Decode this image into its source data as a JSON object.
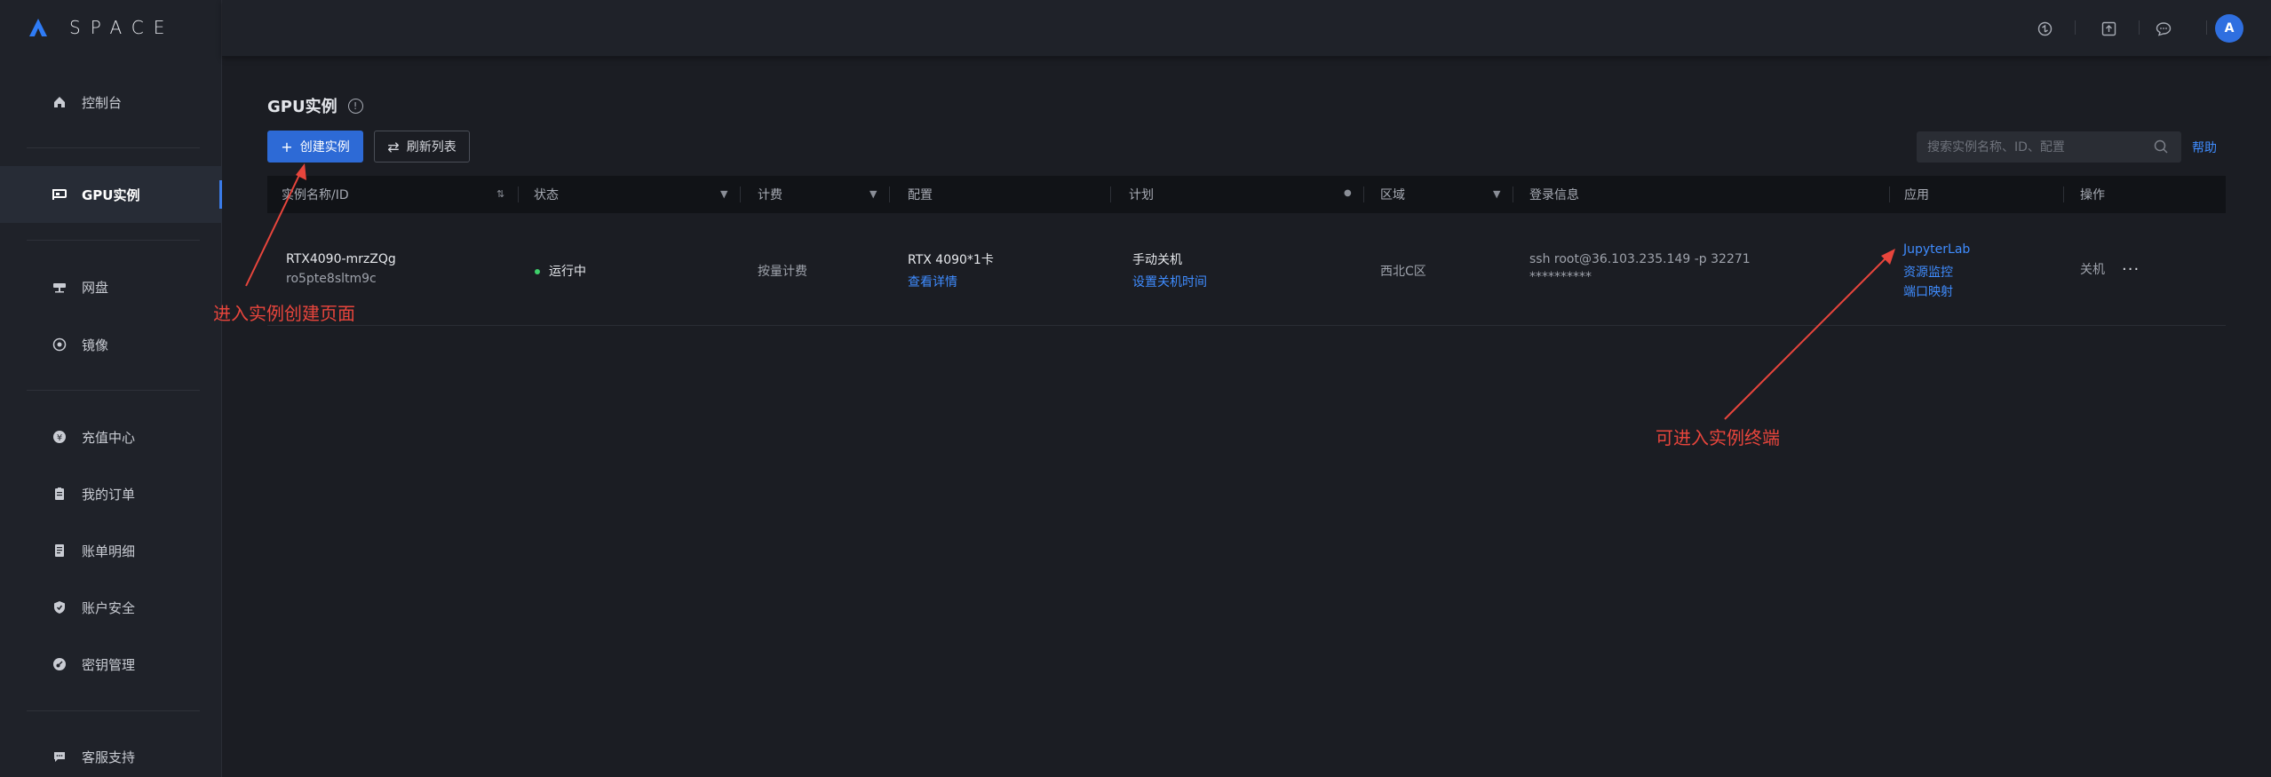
{
  "app": {
    "logo_text": "SPACE"
  },
  "sidebar": {
    "items": [
      {
        "label": "控制台",
        "icon": "home-icon"
      },
      {
        "label": "GPU实例",
        "icon": "gpu-icon",
        "active": true
      },
      {
        "label": "网盘",
        "icon": "disk-icon"
      },
      {
        "label": "镜像",
        "icon": "image-icon"
      },
      {
        "label": "充值中心",
        "icon": "yen-icon"
      },
      {
        "label": "我的订单",
        "icon": "clipboard-icon"
      },
      {
        "label": "账单明细",
        "icon": "bill-icon"
      },
      {
        "label": "账户安全",
        "icon": "shield-icon"
      },
      {
        "label": "密钥管理",
        "icon": "key-icon"
      },
      {
        "label": "客服支持",
        "icon": "chat-icon"
      }
    ]
  },
  "header": {
    "icons": [
      "sync-icon",
      "upload-icon",
      "message-icon"
    ],
    "avatar_initial": "A"
  },
  "main": {
    "title": "GPU实例",
    "create_button": "创建实例",
    "refresh_button": "刷新列表",
    "search_placeholder": "搜索实例名称、ID、配置",
    "help_link": "帮助"
  },
  "table": {
    "columns": [
      "实例名称/ID",
      "状态",
      "计费",
      "配置",
      "计划",
      "区域",
      "登录信息",
      "应用",
      "操作"
    ],
    "rows": [
      {
        "name": "RTX4090-mrzZQg",
        "id": "ro5pte8sltm9c",
        "status": "运行中",
        "billing": "按量计费",
        "config": "RTX 4090*1卡",
        "config_link": "查看详情",
        "plan": "手动关机",
        "plan_link": "设置关机时间",
        "region": "西北C区",
        "login_cmd": "ssh root@36.103.235.149 -p 32271",
        "login_password": "**********",
        "apps": [
          "JupyterLab",
          "资源监控",
          "端口映射"
        ],
        "action": "关机",
        "more": "···"
      }
    ]
  },
  "annotations": {
    "create_note": "进入实例创建页面",
    "terminal_note": "可进入实例终端"
  },
  "colors": {
    "accent": "#2d6ad6",
    "link": "#3f8cff",
    "annotation": "#e8453c",
    "running": "#3ecf6a"
  }
}
